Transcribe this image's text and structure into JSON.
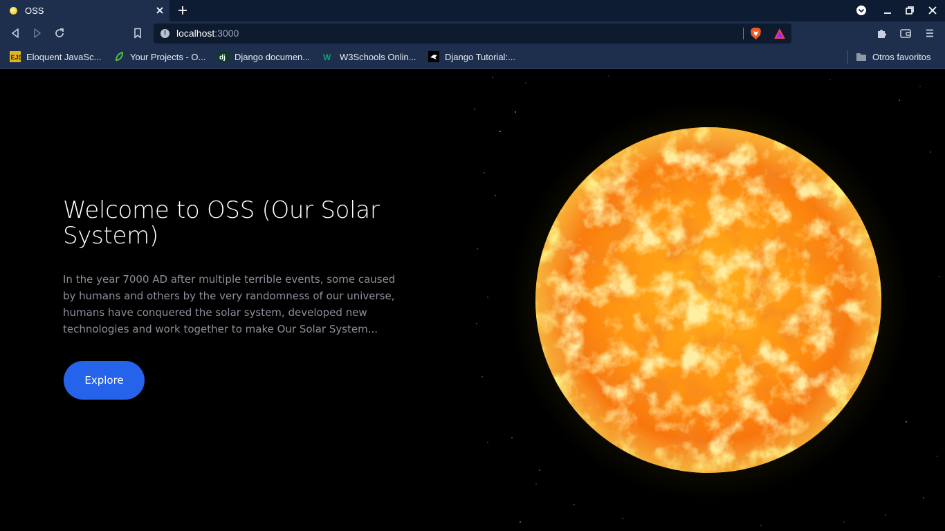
{
  "browser": {
    "tab_title": "OSS",
    "url_host": "localhost",
    "url_port": ":3000",
    "accent_color": "#1e2f4d",
    "bookmarks": [
      {
        "label": "Eloquent JavaSc...",
        "icon": "ejs-icon"
      },
      {
        "label": "Your Projects - O...",
        "icon": "leaf-icon"
      },
      {
        "label": "Django documen...",
        "icon": "django-icon"
      },
      {
        "label": "W3Schools Onlin...",
        "icon": "w3schools-icon"
      },
      {
        "label": "Django Tutorial:...",
        "icon": "eagle-icon"
      }
    ],
    "other_bookmarks": "Otros favoritos"
  },
  "hero": {
    "title": "Welcome to OSS (Our Solar System)",
    "description": "In the year 7000 AD after multiple terrible events, some caused by humans and others by the very randomness of our universe, humans have conquered the solar system, developed new technologies and work together to make Our Solar System...",
    "button_label": "Explore",
    "button_color": "#2563eb",
    "image": "sun-illustration"
  }
}
